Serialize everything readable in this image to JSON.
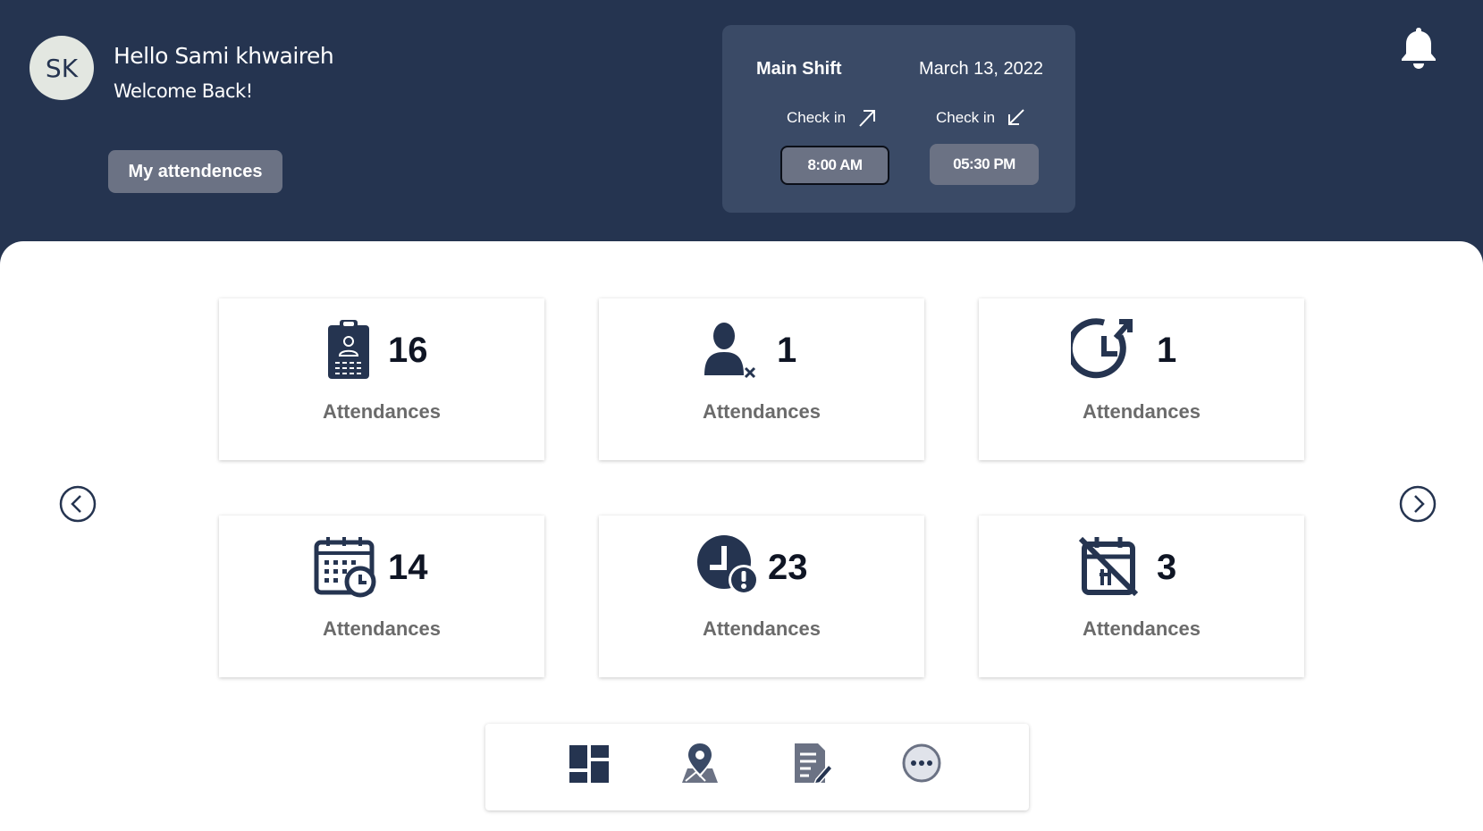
{
  "header": {
    "avatar_initials": "SK",
    "greeting": "Hello Sami khwaireh",
    "welcome": "Welcome Back!",
    "my_attendances_label": "My attendences"
  },
  "shift": {
    "name": "Main Shift",
    "date": "March 13, 2022",
    "check_in_1_label": "Check in",
    "check_in_2_label": "Check in",
    "time_1": "8:00 AM",
    "time_2": "05:30 PM"
  },
  "cards": [
    {
      "icon": "clipboard-badge-icon",
      "count": "16",
      "label": "Attendances"
    },
    {
      "icon": "user-absent-icon",
      "count": "1",
      "label": "Attendances"
    },
    {
      "icon": "clock-arrow-icon",
      "count": "1",
      "label": "Attendances"
    },
    {
      "icon": "calendar-clock-icon",
      "count": "14",
      "label": "Attendances"
    },
    {
      "icon": "clock-alert-icon",
      "count": "23",
      "label": "Attendances"
    },
    {
      "icon": "calendar-cancel-icon",
      "count": "3",
      "label": "Attendances"
    }
  ],
  "bottom_nav": [
    {
      "icon": "dashboard-icon"
    },
    {
      "icon": "map-pin-icon"
    },
    {
      "icon": "report-edit-icon"
    },
    {
      "icon": "more-icon"
    }
  ],
  "colors": {
    "header_bg": "#253450",
    "shift_card_bg": "#3a4a66",
    "button_bg": "#6b7284",
    "icon_dark": "#253450"
  }
}
